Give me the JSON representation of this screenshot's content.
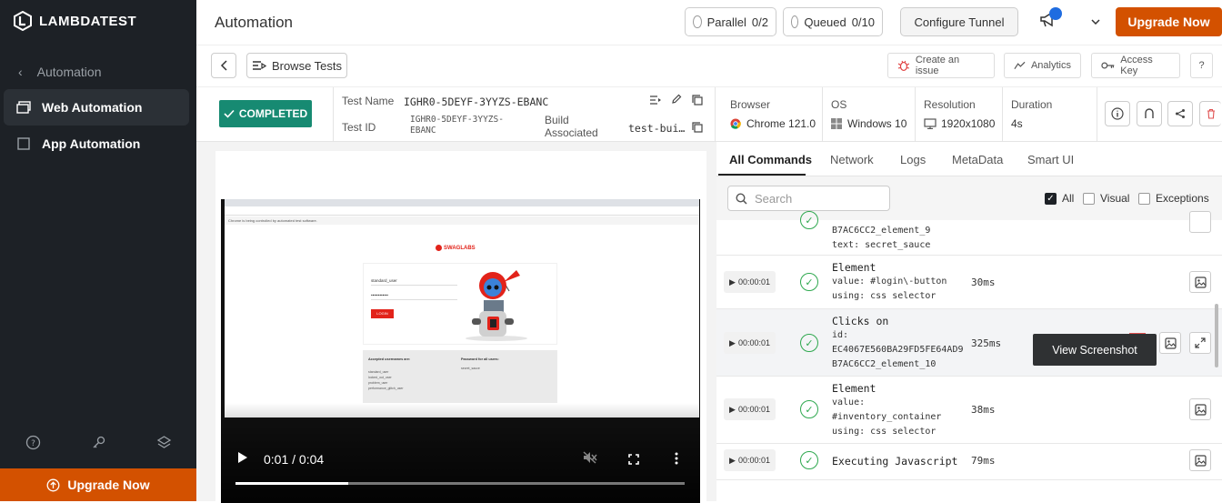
{
  "sidebar": {
    "logo_text": "LAMBDATEST",
    "back_label": "Automation",
    "items": [
      {
        "label": "Web Automation",
        "active": true
      },
      {
        "label": "App Automation",
        "active": false
      }
    ],
    "upgrade_label": "Upgrade Now"
  },
  "topbar": {
    "title": "Automation",
    "parallel_label": "Parallel",
    "parallel_value": "0/2",
    "queued_label": "Queued",
    "queued_value": "0/10",
    "tunnel_label": "Configure Tunnel",
    "upgrade_label": "Upgrade Now"
  },
  "toolbar": {
    "browse_tests_label": "Browse Tests",
    "create_issue_label": "Create an issue",
    "analytics_label": "Analytics",
    "access_key_label": "Access Key",
    "help_label": "?"
  },
  "test_info": {
    "status": "COMPLETED",
    "test_name_label": "Test Name",
    "test_name_value": "IGHR0-5DEYF-3YYZS-EBANC",
    "test_id_label": "Test ID",
    "test_id_line1": "IGHR0-5DEYF-3YYZS-",
    "test_id_line2": "EBANC",
    "build_label_line1": "Build",
    "build_label_line2": "Associated",
    "build_value": "test-bui…",
    "browser_label": "Browser",
    "browser_value": "Chrome 121.0",
    "os_label": "OS",
    "os_value": "Windows 10",
    "resolution_label": "Resolution",
    "resolution_value": "1920x1080",
    "duration_label": "Duration",
    "duration_value": "4s"
  },
  "video": {
    "current_time": "0:01",
    "total_time": "0:04",
    "time_separator": "/",
    "progress_fraction": 0.25,
    "infobar_text": "Chrome is being controlled by automated test software.",
    "brand": "SWAGLABS",
    "username": "standard_user",
    "password_mask": "••••••••••••",
    "login_button": "LOGIN",
    "accepted_heading": "Accepted usernames are:",
    "accepted_users": [
      "standard_user",
      "locked_out_user",
      "problem_user",
      "performance_glitch_user"
    ],
    "password_heading": "Password for all users:",
    "password_value": "secret_sauce"
  },
  "tabs": [
    "All Commands",
    "Network",
    "Logs",
    "MetaData",
    "Smart UI"
  ],
  "filters": {
    "search_placeholder": "Search",
    "all_label": "All",
    "visual_label": "Visual",
    "exceptions_label": "Exceptions"
  },
  "commands": [
    {
      "time": "",
      "lines": [
        "B7AC6CC2_element_9",
        "text: secret_sauce"
      ],
      "duration": ""
    },
    {
      "time": "00:00:01",
      "lines": [
        "Element",
        "value: #login\\-button",
        "using: css selector"
      ],
      "duration": "30ms"
    },
    {
      "time": "00:00:01",
      "lines": [
        "Clicks on",
        "id:",
        "EC4067E560BA29FD5FE64AD9",
        "B7AC6CC2_element_10"
      ],
      "duration": "325ms"
    },
    {
      "time": "00:00:01",
      "lines": [
        "Element",
        "value:",
        "#inventory_container",
        "using: css selector"
      ],
      "duration": "38ms"
    },
    {
      "time": "00:00:01",
      "lines": [
        "Executing Javascript"
      ],
      "duration": "79ms"
    }
  ],
  "tooltip": "View Screenshot",
  "colors": {
    "sidebar_bg": "#1d2126",
    "brand_orange": "#d35100",
    "completed_green": "#178a72",
    "success_green": "#2fa84f",
    "notification_blue": "#1f6ce0"
  }
}
